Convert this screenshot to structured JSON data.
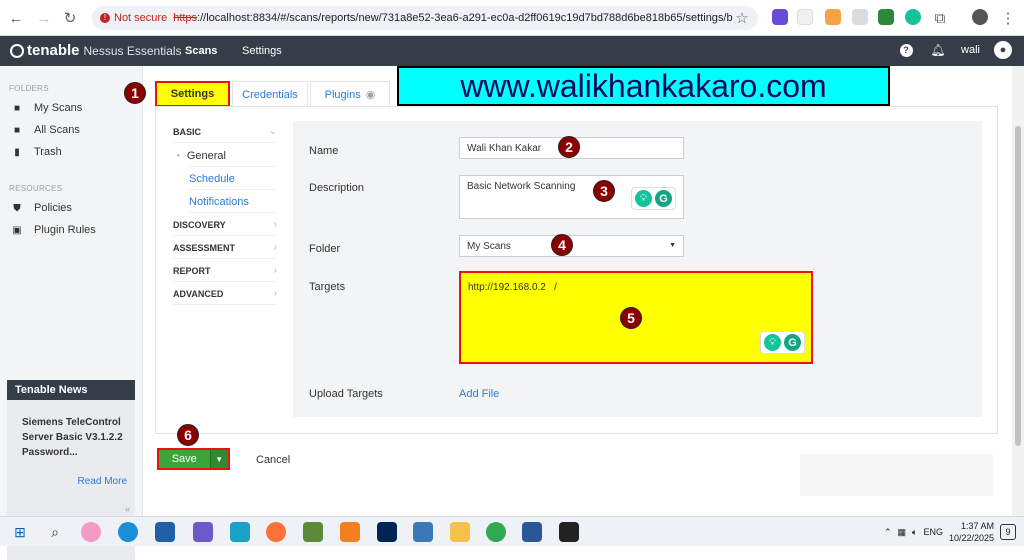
{
  "browser": {
    "not_secure": "Not secure",
    "url_scheme": "https",
    "url_rest": "://localhost:8834/#/scans/reports/new/731a8e52-3ea6-a291-ec0a-d2ff0619c19d7bd788d6be818b65/settings/ba..."
  },
  "header": {
    "brand": "tenable",
    "product": "Nessus Essentials",
    "nav": [
      "Scans",
      "Settings"
    ],
    "user": "wali"
  },
  "sidebar": {
    "folders_label": "FOLDERS",
    "folders": [
      "My Scans",
      "All Scans",
      "Trash"
    ],
    "resources_label": "RESOURCES",
    "resources": [
      "Policies",
      "Plugin Rules"
    ],
    "news_title": "Tenable News",
    "news_item": "Siemens TeleControl Server Basic V3.1.2.2 Password...",
    "read_more": "Read More",
    "collapse": "«"
  },
  "tabs": [
    "Settings",
    "Credentials",
    "Plugins"
  ],
  "watermark": "www.walikhankakaro.com",
  "sections": {
    "basic": "BASIC",
    "sub": [
      "General",
      "Schedule",
      "Notifications"
    ],
    "others": [
      "DISCOVERY",
      "ASSESSMENT",
      "REPORT",
      "ADVANCED"
    ]
  },
  "form": {
    "name_label": "Name",
    "name_value": "Wali Khan Kakar",
    "description_label": "Description",
    "description_value": "Basic Network Scanning",
    "folder_label": "Folder",
    "folder_value": "My Scans",
    "targets_label": "Targets",
    "targets_value": "http://192.168.0.2   /",
    "upload_label": "Upload Targets",
    "add_file": "Add File"
  },
  "actions": {
    "save": "Save",
    "cancel": "Cancel"
  },
  "badges": [
    "1",
    "2",
    "3",
    "4",
    "5",
    "6"
  ],
  "taskbar": {
    "lang": "ENG",
    "time": "1:37 AM",
    "date": "10/22/2025",
    "notif": "9"
  }
}
